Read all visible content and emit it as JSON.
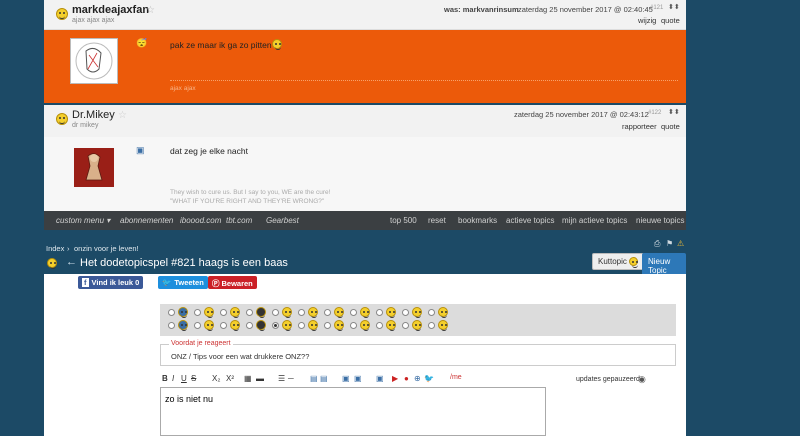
{
  "post1": {
    "username": "markdeajaxfan",
    "subname": "ajax ajax ajax",
    "was": "was: markvanrinsum",
    "date": "zaterdag 25 november 2017 @ 02:40:45",
    "num": "#121",
    "links": [
      "wijzig",
      "quote"
    ],
    "text": "pak ze maar ik ga zo pitten",
    "signature": "ajax ajax"
  },
  "post2": {
    "username": "Dr.Mikey",
    "subname": "dr mikey",
    "date": "zaterdag 25 november 2017 @ 02:43:12",
    "num": "#122",
    "links": [
      "rapporteer",
      "quote"
    ],
    "text": "dat zeg je elke nacht",
    "signature_1": "They wish to cure us. But I say to you, WE are the cure!",
    "signature_2": "\"WHAT IF YOU'RE RIGHT AND THEY'RE WRONG?\""
  },
  "navbar": {
    "left": [
      "custom menu ▾",
      "abonnementen",
      "iboood.com",
      "tbt.com",
      "Gearbest"
    ],
    "right": [
      "top 500",
      "reset",
      "bookmarks",
      "actieve topics",
      "mijn actieve topics",
      "nieuwe topics"
    ]
  },
  "topic": {
    "crumbs": [
      "Index",
      "onzin voor je leven!"
    ],
    "title": "Het dodetopicspel #821 haags is een baas",
    "kuttopic": "Kuttopic",
    "new_topic": "Nieuw Topic"
  },
  "share": {
    "facebook": "Vind ik leuk 0",
    "twitter": "Tweeten",
    "pinterest": "Bewaren"
  },
  "reply": {
    "note_title": "Voordat je reageert",
    "note_text": "ONZ / Tips voor een wat drukkere ONZ??",
    "updates": "updates gepauzeerd",
    "editor_text": "zo is niet nu",
    "toolbar": [
      "B",
      "I",
      "U",
      "S",
      "X₂",
      "X²",
      "/me"
    ]
  },
  "colors": {
    "post_orange": "#ec5a0a",
    "page_blue": "#1c4a66",
    "navbar": "#3b3f42",
    "facebook": "#3b5998",
    "twitter": "#1d8fdd",
    "pinterest": "#cb2027",
    "new_topic": "#2d78b8"
  }
}
